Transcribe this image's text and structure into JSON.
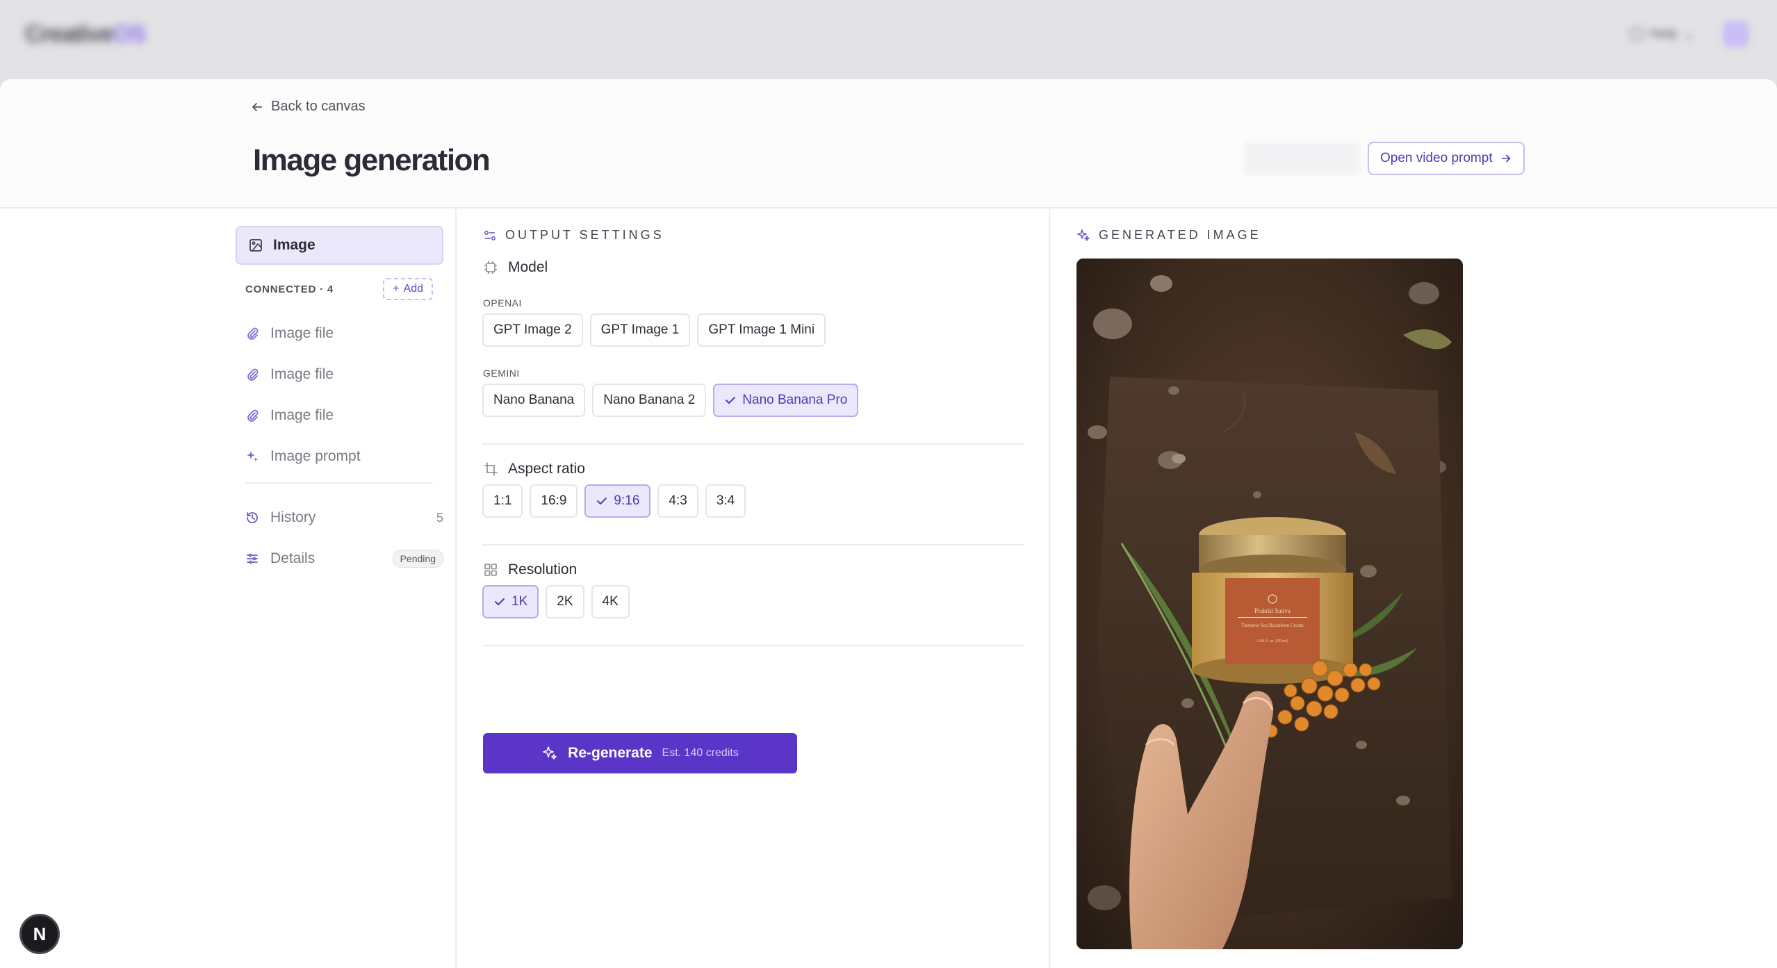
{
  "topbar": {
    "brand_main": "Creative",
    "brand_accent": "OS",
    "help_label": "Help"
  },
  "header": {
    "back_label": "Back to canvas",
    "title": "Image generation",
    "video_button": "Open video prompt"
  },
  "sidebar": {
    "active_item": "Image",
    "connected_label": "CONNECTED · 4",
    "add_label": "Add",
    "connected_items": [
      {
        "label": "Image file",
        "icon": "paperclip-icon"
      },
      {
        "label": "Image file",
        "icon": "paperclip-icon"
      },
      {
        "label": "Image file",
        "icon": "paperclip-icon"
      },
      {
        "label": "Image prompt",
        "icon": "sparkle-icon"
      }
    ],
    "history_label": "History",
    "history_count": "5",
    "details_label": "Details",
    "details_badge": "Pending"
  },
  "settings": {
    "section_title": "OUTPUT SETTINGS",
    "model_label": "Model",
    "openai_label": "OPENAI",
    "openai_models": [
      "GPT Image 2",
      "GPT Image 1",
      "GPT Image 1 Mini"
    ],
    "gemini_label": "GEMINI",
    "gemini_models": [
      "Nano Banana",
      "Nano Banana 2",
      "Nano Banana Pro"
    ],
    "selected_model": "Nano Banana Pro",
    "aspect_label": "Aspect ratio",
    "aspect_options": [
      "1:1",
      "16:9",
      "9:16",
      "4:3",
      "3:4"
    ],
    "selected_aspect": "9:16",
    "resolution_label": "Resolution",
    "resolution_options": [
      "1K",
      "2K",
      "4K"
    ],
    "selected_resolution": "1K",
    "regenerate_label": "Re-generate",
    "regenerate_credits": "Est. 140 credits"
  },
  "preview": {
    "section_title": "GENERATED IMAGE",
    "jar_brand": "Prakriti Sattva",
    "jar_product": "Turmeric Sea Buckthorn Cream",
    "jar_size": "1.69 fl. oz. (50 ml)"
  },
  "colors": {
    "accent": "#5b35c8",
    "accent_soft": "#ece8fb",
    "border": "#ececef"
  },
  "dev_badge": "N"
}
